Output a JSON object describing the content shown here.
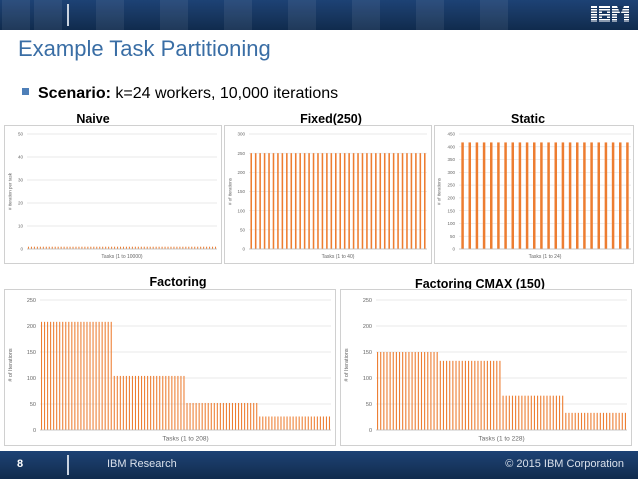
{
  "header": {
    "logo_text": "IBM"
  },
  "slide": {
    "title": "Example Task Partitioning",
    "bullet_label": "Scenario:",
    "bullet_text": " k=24 workers, 10,000 iterations"
  },
  "footer": {
    "page_number": "8",
    "org": "IBM Research",
    "copyright": "© 2015 IBM Corporation"
  },
  "colors": {
    "accent_blue": "#3a6ea5",
    "bar_orange": "#ed7d31",
    "header_navy": "#17365f"
  },
  "chart_data": [
    {
      "type": "bar",
      "title": "Naive",
      "xlabel": "Tasks (1 to 10000)",
      "ylabel": "# iteration per task",
      "ylim": [
        0,
        50
      ],
      "yticks": [
        "0",
        "10",
        "20",
        "30",
        "40",
        "50"
      ],
      "values": [
        1,
        1,
        1,
        1,
        1,
        1,
        1,
        1,
        1,
        1,
        1,
        1,
        1,
        1,
        1,
        1,
        1,
        1,
        1,
        1,
        1,
        1,
        1,
        1,
        1,
        1,
        1,
        1,
        1,
        1,
        1,
        1,
        1,
        1,
        1,
        1,
        1,
        1,
        1,
        1,
        1,
        1,
        1,
        1,
        1,
        1,
        1,
        1,
        1,
        1,
        1,
        1,
        1,
        1,
        1,
        1,
        1,
        1,
        1,
        1,
        1,
        1,
        1,
        1
      ],
      "grid": true
    },
    {
      "type": "bar",
      "title": "Fixed(250)",
      "xlabel": "Tasks (1 to 40)",
      "ylabel": "# of iterations",
      "ylim": [
        0,
        300
      ],
      "yticks": [
        "0",
        "50",
        "100",
        "150",
        "200",
        "250",
        "300"
      ],
      "values": [
        250,
        250,
        250,
        250,
        250,
        250,
        250,
        250,
        250,
        250,
        250,
        250,
        250,
        250,
        250,
        250,
        250,
        250,
        250,
        250,
        250,
        250,
        250,
        250,
        250,
        250,
        250,
        250,
        250,
        250,
        250,
        250,
        250,
        250,
        250,
        250,
        250,
        250,
        250,
        250
      ],
      "grid": true
    },
    {
      "type": "bar",
      "title": "Static",
      "xlabel": "Tasks (1 to 24)",
      "ylabel": "# of iterations",
      "ylim": [
        0,
        450
      ],
      "yticks": [
        "0",
        "50",
        "100",
        "150",
        "200",
        "250",
        "300",
        "350",
        "400",
        "450"
      ],
      "values": [
        417,
        417,
        417,
        417,
        417,
        417,
        417,
        417,
        417,
        417,
        417,
        417,
        417,
        417,
        417,
        417,
        417,
        417,
        417,
        417,
        417,
        417,
        417,
        417
      ],
      "grid": true
    },
    {
      "type": "bar",
      "title": "Factoring",
      "xlabel": "Tasks (1 to 208)",
      "ylabel": "# of Iterations",
      "ylim": [
        0,
        250
      ],
      "yticks": [
        "0",
        "50",
        "100",
        "150",
        "200",
        "250"
      ],
      "groups": [
        {
          "count": 24,
          "value": 208
        },
        {
          "count": 24,
          "value": 104
        },
        {
          "count": 24,
          "value": 52
        },
        {
          "count": 24,
          "value": 26
        }
      ],
      "grid": true
    },
    {
      "type": "bar",
      "title": "Factoring CMAX (150)",
      "xlabel": "Tasks (1 to 228)",
      "ylabel": "# of Iterations",
      "ylim": [
        0,
        250
      ],
      "yticks": [
        "0",
        "50",
        "100",
        "150",
        "200",
        "250"
      ],
      "groups": [
        {
          "count": 20,
          "value": 150
        },
        {
          "count": 20,
          "value": 133
        },
        {
          "count": 20,
          "value": 66
        },
        {
          "count": 20,
          "value": 33
        }
      ],
      "grid": true
    }
  ]
}
